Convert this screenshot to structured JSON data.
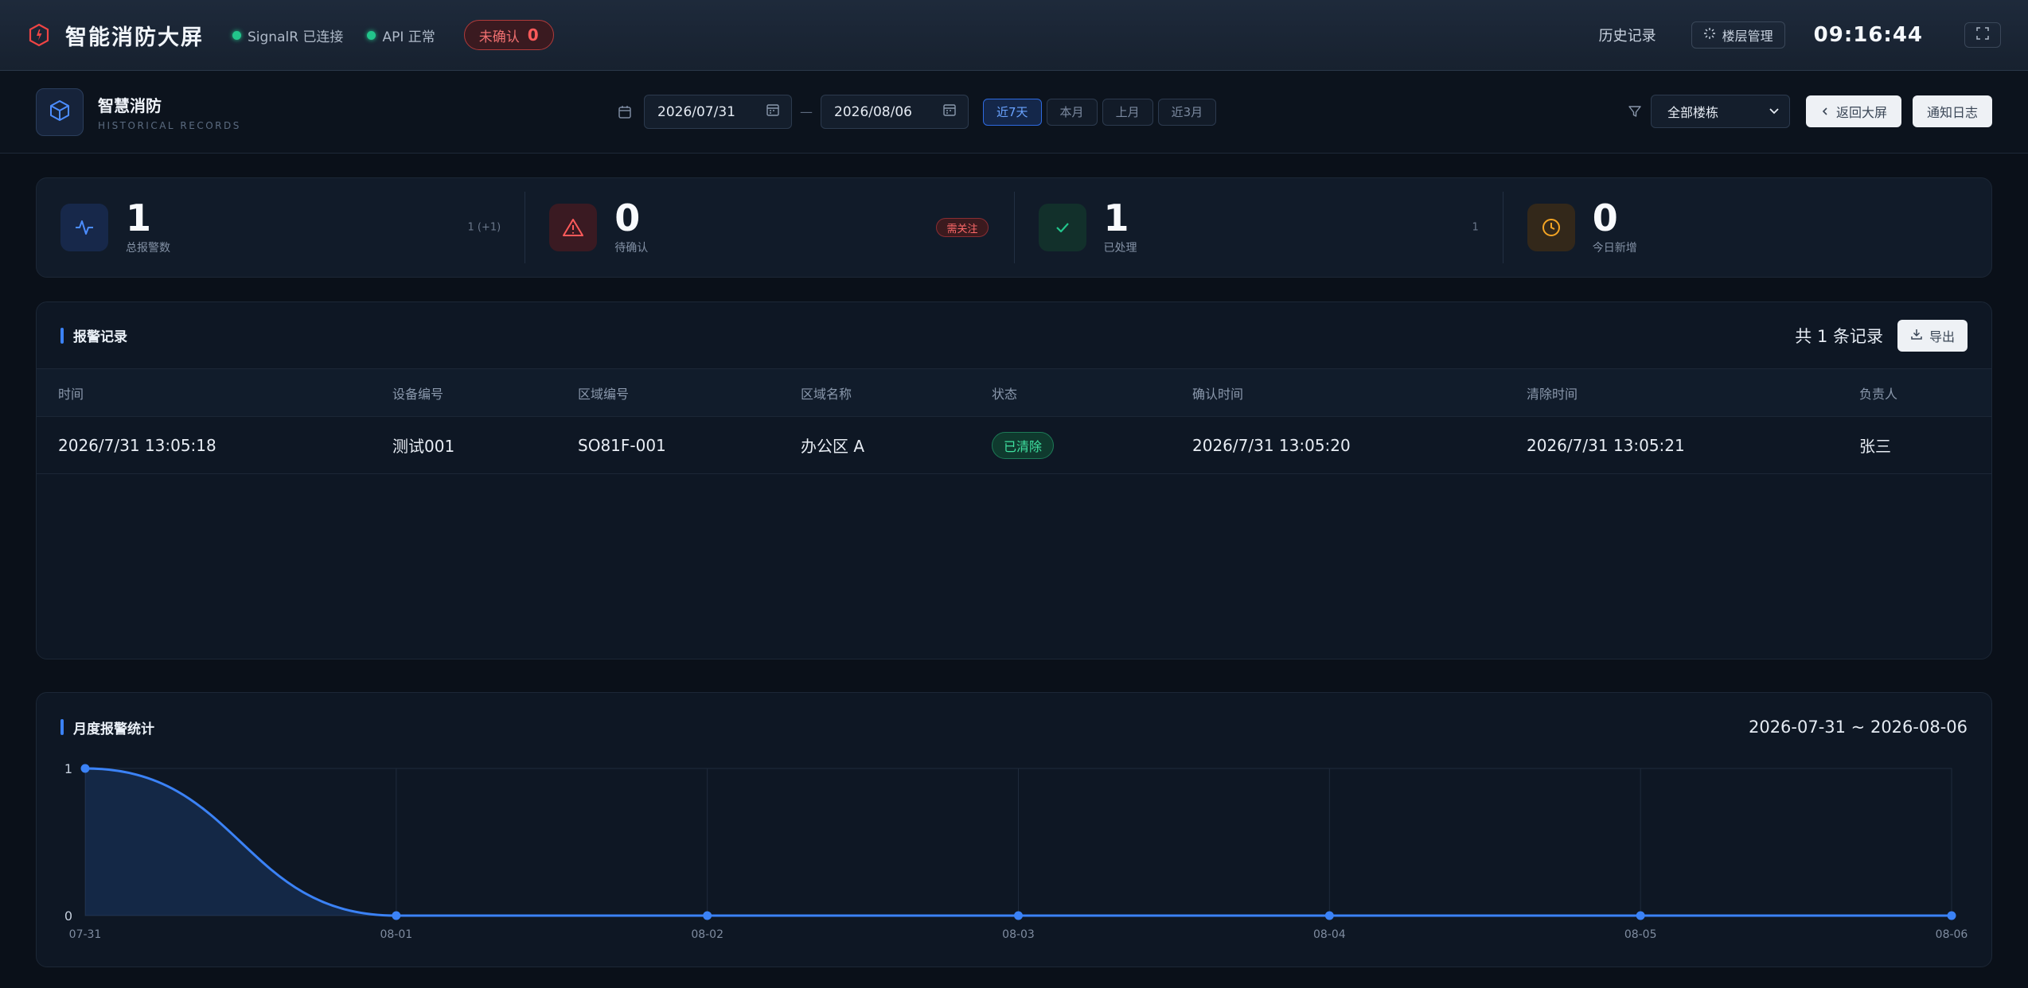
{
  "header": {
    "title": "智能消防大屏",
    "signalr_status": "SignalR 已连接",
    "api_status": "API 正常",
    "unconfirmed_label": "未确认",
    "unconfirmed_count": "0",
    "history_link": "历史记录",
    "floor_mgmt_label": "楼层管理",
    "clock": "09:16:44"
  },
  "subheader": {
    "app_name": "智慧消防",
    "app_subtitle": "HISTORICAL RECORDS",
    "date_from": "2026/07/31",
    "date_to": "2026/08/06",
    "date_separator": "—",
    "quick_ranges": [
      {
        "label": "近7天",
        "active": true
      },
      {
        "label": "本月",
        "active": false
      },
      {
        "label": "上月",
        "active": false
      },
      {
        "label": "近3月",
        "active": false
      }
    ],
    "building_select": "全部楼栋",
    "back_button": "返回大屏",
    "log_button": "通知日志"
  },
  "stats": [
    {
      "value": "1",
      "label": "总报警数",
      "side": "1 (+1)",
      "icon": "activity-icon",
      "color": "#4c8dff"
    },
    {
      "value": "0",
      "label": "待确认",
      "badge": "需关注",
      "icon": "warning-icon",
      "color": "#ff5a5a"
    },
    {
      "value": "1",
      "label": "已处理",
      "side": "1",
      "icon": "check-icon",
      "color": "#22c58b"
    },
    {
      "value": "0",
      "label": "今日新增",
      "icon": "clock-icon",
      "color": "#f5a524"
    }
  ],
  "records": {
    "title": "报警记录",
    "count_text": "共 1 条记录",
    "export_button": "导出",
    "columns": [
      "时间",
      "设备编号",
      "区域编号",
      "区域名称",
      "状态",
      "确认时间",
      "清除时间",
      "负责人"
    ],
    "rows": [
      {
        "time": "2026/7/31 13:05:18",
        "device": "测试001",
        "area_code": "SO81F-001",
        "area_name": "办公区 A",
        "status": "已清除",
        "confirm_time": "2026/7/31 13:05:20",
        "clear_time": "2026/7/31 13:05:21",
        "owner": "张三"
      }
    ]
  },
  "chart": {
    "title": "月度报警统计",
    "range_text": "2026-07-31 ~ 2026-08-06"
  },
  "chart_data": {
    "type": "area",
    "categories": [
      "07-31",
      "08-01",
      "08-02",
      "08-03",
      "08-04",
      "08-05",
      "08-06"
    ],
    "values": [
      1,
      0,
      0,
      0,
      0,
      0,
      0
    ],
    "ylim": [
      0,
      1
    ],
    "yticks": [
      0,
      1
    ],
    "grid": true,
    "line_color": "#3b82f6"
  },
  "colors": {
    "accent": "#3b82f6",
    "success": "#22c58b",
    "danger": "#ff5a5a",
    "warning": "#f5a524"
  }
}
